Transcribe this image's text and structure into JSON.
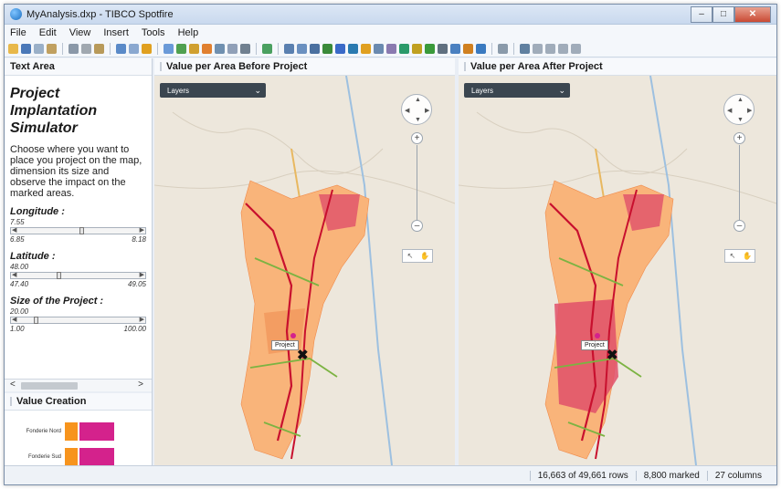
{
  "window": {
    "title": "MyAnalysis.dxp - TIBCO Spotfire",
    "minimize": "–",
    "maximize": "□",
    "close": "✕"
  },
  "menu": {
    "items": [
      "File",
      "Edit",
      "View",
      "Insert",
      "Tools",
      "Help"
    ]
  },
  "text_area": {
    "header": "Text Area",
    "title_line1": "Project",
    "title_line2": "Implantation",
    "title_line3": "Simulator",
    "description": "Choose where you want to place you project on the map, dimension its size and observe the impact on the marked areas.",
    "longitude": {
      "label": "Longitude :",
      "value": "7.55",
      "min": "6.85",
      "max": "8.18",
      "level": 0.53
    },
    "latitude": {
      "label": "Latitude :",
      "value": "48.00",
      "min": "47.40",
      "max": "49.05",
      "level": 0.36
    },
    "size": {
      "label": "Size of the Project :",
      "value": "20.00",
      "min": "1.00",
      "max": "100.00",
      "level": 0.19
    }
  },
  "value_creation": {
    "header": "Value Creation",
    "categories": [
      "Fonderie Nord",
      "Fonderie Sud"
    ]
  },
  "map_before": {
    "header": "Value per Area Before Project",
    "layers": "Layers",
    "project_label": "Project"
  },
  "map_after": {
    "header": "Value per Area After Project",
    "layers": "Layers",
    "project_label": "Project"
  },
  "status": {
    "rows": "16,663 of 49,661 rows",
    "marked": "8,800 marked",
    "columns": "27 columns"
  },
  "colors": {
    "orange": "#f7941d",
    "magenta": "#d4228c",
    "region_light": "#f9b47a",
    "region_dark": "#e0506a",
    "road": "#c8102e",
    "green_road": "#7cb342"
  }
}
